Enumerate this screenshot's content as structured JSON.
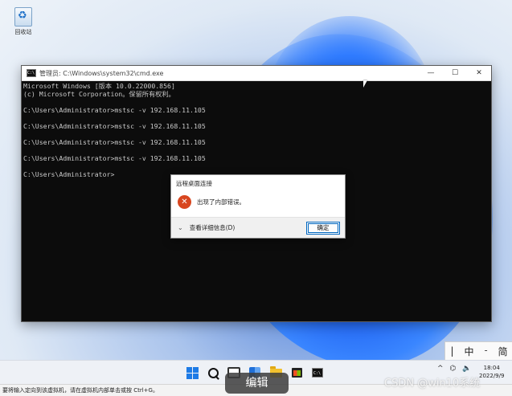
{
  "desktop": {
    "recycle_bin_label": "回收站"
  },
  "cmd_window": {
    "icon_text": "C:\\",
    "title": "管理员: C:\\Windows\\system32\\cmd.exe",
    "buttons": {
      "minimize": "—",
      "maximize": "☐",
      "close": "✕"
    },
    "lines": [
      "Microsoft Windows [版本 10.0.22000.856]",
      "(c) Microsoft Corporation。保留所有权利。",
      "",
      "C:\\Users\\Administrator>mstsc -v 192.168.11.105",
      "",
      "C:\\Users\\Administrator>mstsc -v 192.168.11.105",
      "",
      "C:\\Users\\Administrator>mstsc -v 192.168.11.105",
      "",
      "C:\\Users\\Administrator>mstsc -v 192.168.11.105",
      "",
      "C:\\Users\\Administrator>"
    ]
  },
  "dialog": {
    "title": "远程桌面连接",
    "error_glyph": "✕",
    "message": "出现了内部错误。",
    "chevron": "⌄",
    "details_label": "查看详细信息(D)",
    "ok_label": "确定"
  },
  "ime": {
    "items": [
      "|",
      "中",
      "ᱼ",
      "简"
    ]
  },
  "taskbar": {
    "cmd_icon_text": "C:\\",
    "tray": {
      "chevron": "^",
      "network": "⌬",
      "volume": "🔈"
    },
    "clock_time": "18:04",
    "clock_date": "2022/9/9"
  },
  "statusbar": {
    "text": "要将输入定向到该虚拟机，请在虚拟机内部单击或按 Ctrl+G。"
  },
  "overlay": {
    "edit_label": "编辑",
    "watermark": "CSDN @win10系统"
  },
  "colors": {
    "accent": "#0067c0",
    "error": "#d8461f",
    "console_bg": "#0c0c0c",
    "console_fg": "#c8c8c8"
  }
}
